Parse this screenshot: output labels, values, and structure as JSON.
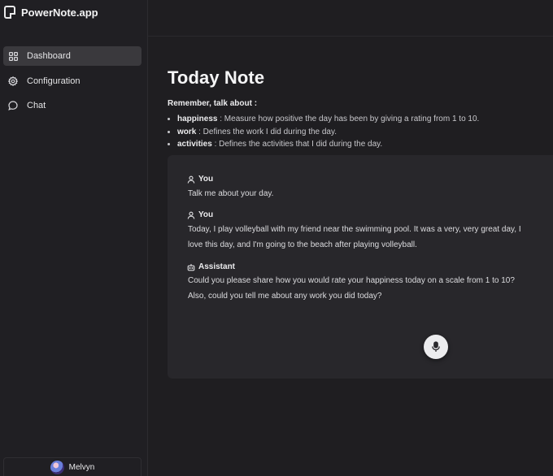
{
  "app": {
    "name": "PowerNote.app"
  },
  "sidebar": {
    "items": [
      {
        "label": "Dashboard",
        "icon": "grid-icon",
        "active": true
      },
      {
        "label": "Configuration",
        "icon": "gear-icon",
        "active": false
      },
      {
        "label": "Chat",
        "icon": "chat-bubble-icon",
        "active": false
      }
    ],
    "user": {
      "name": "Melvyn"
    }
  },
  "main": {
    "title": "Today Note",
    "remember_label": "Remember, talk about :",
    "topics": [
      {
        "key": "happiness",
        "desc": " : Measure how positive the day has been by giving a rating from 1 to 10."
      },
      {
        "key": "work",
        "desc": " : Defines the work I did during the day."
      },
      {
        "key": "activities",
        "desc": " : Defines the activities that I did during the day."
      }
    ]
  },
  "chat": {
    "messages": [
      {
        "role": "You",
        "lines": [
          "Talk me about your day."
        ]
      },
      {
        "role": "You",
        "lines": [
          "Today, I play volleyball with my friend near the swimming pool. It was a very, very great day, I",
          "love this day, and I'm going to the beach after playing volleyball."
        ]
      },
      {
        "role": "Assistant",
        "lines": [
          "Could you please share how you would rate your happiness today on a scale from 1 to 10?",
          "Also, could you tell me about any work you did today?"
        ]
      }
    ],
    "mic_icon": "microphone-icon"
  }
}
